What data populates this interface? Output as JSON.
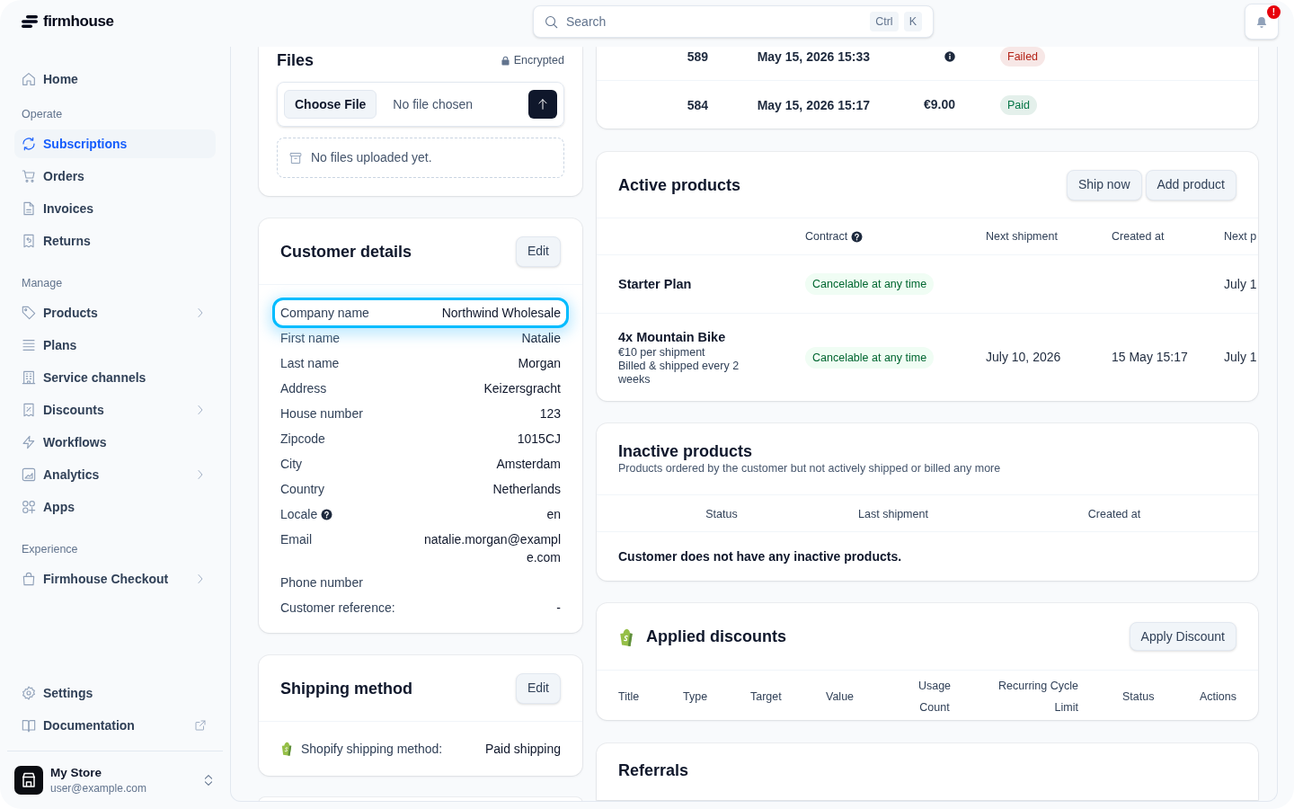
{
  "sidebar": {
    "logo": "firmhouse",
    "sections": [
      {
        "items": [
          {
            "label": "Home",
            "selected": false,
            "expandable": false
          }
        ]
      },
      {
        "title": "Operate",
        "items": [
          {
            "label": "Subscriptions",
            "selected": true,
            "expandable": false
          },
          {
            "label": "Orders",
            "selected": false,
            "expandable": false
          },
          {
            "label": "Invoices",
            "selected": false,
            "expandable": false
          },
          {
            "label": "Returns",
            "selected": false,
            "expandable": false
          }
        ]
      },
      {
        "title": "Manage",
        "items": [
          {
            "label": "Products",
            "selected": false,
            "expandable": true
          },
          {
            "label": "Plans",
            "selected": false,
            "expandable": false
          },
          {
            "label": "Service channels",
            "selected": false,
            "expandable": false
          },
          {
            "label": "Discounts",
            "selected": false,
            "expandable": true
          },
          {
            "label": "Workflows",
            "selected": false,
            "expandable": false
          },
          {
            "label": "Analytics",
            "selected": false,
            "expandable": true
          },
          {
            "label": "Apps",
            "selected": false,
            "expandable": false
          }
        ]
      },
      {
        "title": "Experience",
        "items": [
          {
            "label": "Firmhouse Checkout",
            "selected": false,
            "expandable": true
          }
        ]
      }
    ],
    "footer_items": [
      {
        "label": "Settings",
        "selected": false,
        "external": false
      },
      {
        "label": "Documentation",
        "selected": false,
        "external": true
      }
    ],
    "account": {
      "name": "My Store",
      "email": "user@example.com"
    }
  },
  "search": {
    "placeholder": "Search",
    "shortcut_keys": [
      "Ctrl",
      "K"
    ]
  },
  "notifications": {
    "badge": "!"
  },
  "files": {
    "title": "Files",
    "security_label": "Encrypted",
    "file_input": {
      "button": "Choose File",
      "status_text": "No file chosen"
    },
    "empty_message": "No files uploaded yet."
  },
  "customer_details": {
    "title": "Customer details",
    "edit_button": "Edit",
    "rows": [
      {
        "label": "Company name",
        "value": "Northwind Wholesale",
        "highlighted": true,
        "help": false
      },
      {
        "label": "First name",
        "value": "Natalie",
        "highlighted": false,
        "help": false
      },
      {
        "label": "Last name",
        "value": "Morgan",
        "highlighted": false,
        "help": false
      },
      {
        "label": "Address",
        "value": "Keizersgracht",
        "highlighted": false,
        "help": false
      },
      {
        "label": "House number",
        "value": "123",
        "highlighted": false,
        "help": false
      },
      {
        "label": "Zipcode",
        "value": "1015CJ",
        "highlighted": false,
        "help": false
      },
      {
        "label": "City",
        "value": "Amsterdam",
        "highlighted": false,
        "help": false
      },
      {
        "label": "Country",
        "value": "Netherlands",
        "highlighted": false,
        "help": false
      },
      {
        "label": "Locale",
        "value": "en",
        "highlighted": false,
        "help": true
      },
      {
        "label": "Email",
        "value": "natalie.morgan@example.com",
        "highlighted": false,
        "help": false
      },
      {
        "label": "Phone number",
        "highlighted": false,
        "help": false
      },
      {
        "label": "Customer reference:",
        "value": "-",
        "highlighted": false,
        "help": false
      }
    ]
  },
  "shipping_method": {
    "title": "Shipping method",
    "edit_button": "Edit",
    "label": "Shopify shipping method:",
    "value": "Paid shipping"
  },
  "payments": {
    "rows": [
      {
        "number": "589",
        "date": "May 15, 2026 15:33",
        "status": "Failed",
        "color": "#b42318"
      },
      {
        "number": "584",
        "date": "May 15, 2026 15:17",
        "amount": "€9.00",
        "status": "Paid",
        "color": "#067647"
      }
    ]
  },
  "active_products": {
    "title": "Active products",
    "buttons": [
      "Ship now",
      "Add product"
    ],
    "columns": [
      {
        "label": "Contract",
        "help": true
      },
      {
        "label": "Next shipment",
        "help": false
      },
      {
        "label": "Created at",
        "help": false
      },
      {
        "label": "Next p",
        "help": false
      }
    ],
    "rows": [
      {
        "name": "Starter Plan",
        "contract": "Cancelable at any time",
        "column_5": "July 1"
      },
      {
        "name": "4x Mountain Bike",
        "details": [
          "€10 per shipment",
          "Billed & shipped every 2 weeks"
        ],
        "contract": "Cancelable at any time",
        "next_shipment": "July 10, 2026",
        "created_at": "15 May 15:17",
        "column_5": "July 1"
      }
    ]
  },
  "inactive_products": {
    "title": "Inactive products",
    "subtitle": "Products ordered by the customer but not actively shipped or billed any more",
    "columns": [
      "Status",
      "Last shipment",
      "Created at"
    ],
    "empty_message": "Customer does not have any inactive products."
  },
  "applied_discounts": {
    "title": "Applied discounts",
    "button": "Apply Discount",
    "columns": [
      "Title",
      "Type",
      "Target",
      "Value",
      "Usage Count",
      "Recurring Cycle Limit",
      "Status",
      "Actions"
    ]
  },
  "referrals": {
    "title": "Referrals"
  }
}
